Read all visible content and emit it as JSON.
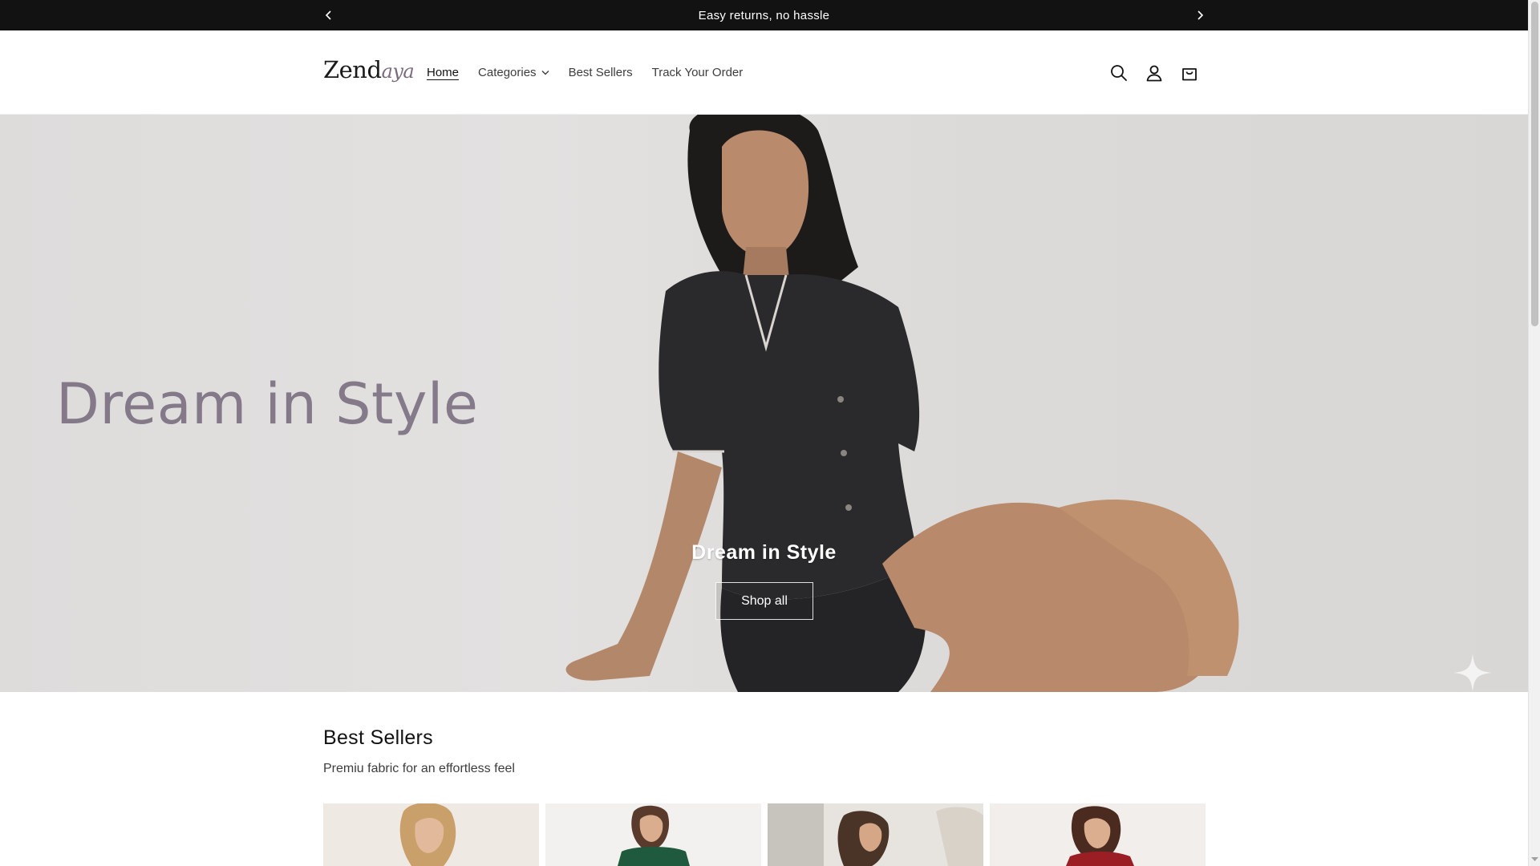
{
  "announcement": {
    "text": "Easy returns, no hassle",
    "prev_icon": "chevron-left-icon",
    "next_icon": "chevron-right-icon"
  },
  "header": {
    "logo_main": "Zend",
    "logo_tail": "aya",
    "nav": [
      {
        "label": "Home",
        "active": true
      },
      {
        "label": "Categories",
        "has_dropdown": true
      },
      {
        "label": "Best Sellers"
      },
      {
        "label": "Track Your Order"
      }
    ],
    "icons": [
      "search-icon",
      "account-icon",
      "cart-icon"
    ]
  },
  "hero": {
    "background_title": "Dream in Style",
    "title": "Dream in Style",
    "button_label": "Shop all"
  },
  "best_sellers": {
    "title": "Best Sellers",
    "subtitle": "Premiu fabric for an effortless feel"
  },
  "colors": {
    "announcement_bg": "#121212",
    "page_bg": "#ffffff",
    "text": "#121212",
    "hero_bg": "#dedcdb"
  }
}
